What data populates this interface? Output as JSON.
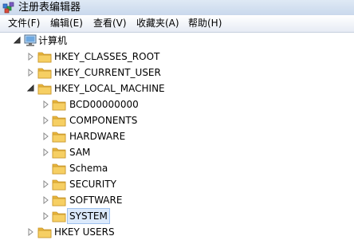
{
  "window": {
    "title": "注册表编辑器"
  },
  "menu": [
    {
      "label": "文件(F)"
    },
    {
      "label": "编辑(E)"
    },
    {
      "label": "查看(V)"
    },
    {
      "label": "收藏夹(A)"
    },
    {
      "label": "帮助(H)"
    }
  ],
  "tree": {
    "root": "计算机",
    "hives": [
      "HKEY_CLASSES_ROOT",
      "HKEY_CURRENT_USER",
      "HKEY_LOCAL_MACHINE",
      "HKEY USERS"
    ],
    "local_machine_keys": [
      "BCD00000000",
      "COMPONENTS",
      "HARDWARE",
      "SAM",
      "Schema",
      "SECURITY",
      "SOFTWARE",
      "SYSTEM"
    ],
    "selected": "SYSTEM"
  },
  "colors": {
    "folder": "#f2c04a",
    "selection_bg": "#dbe9fb",
    "selection_border": "#9fc1ee"
  }
}
